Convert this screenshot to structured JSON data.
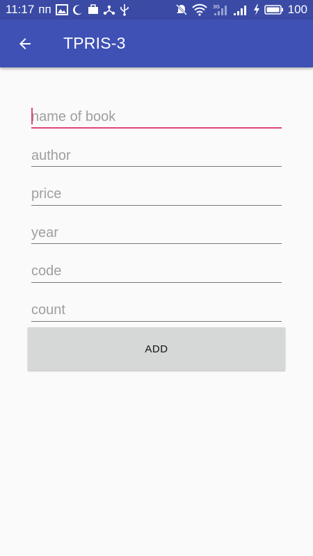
{
  "status_bar": {
    "time": "11:17",
    "carrier_text": "пп",
    "network_type": "3G",
    "battery_level": "100",
    "icons_left": [
      "image-icon",
      "moon-icon",
      "briefcase-icon",
      "share-icon",
      "usb-icon"
    ],
    "icons_right": [
      "mute-icon",
      "wifi-icon",
      "signal-3g-icon",
      "signal-icon",
      "charging-icon",
      "battery-icon"
    ]
  },
  "app_bar": {
    "title": "TPRIS-3",
    "back_icon": "arrow-back-icon",
    "color": "#3f51b5"
  },
  "form": {
    "fields": [
      {
        "placeholder": "name of book",
        "value": "",
        "focused": true
      },
      {
        "placeholder": "author",
        "value": ""
      },
      {
        "placeholder": "price",
        "value": ""
      },
      {
        "placeholder": "year",
        "value": ""
      },
      {
        "placeholder": "code",
        "value": ""
      },
      {
        "placeholder": "count",
        "value": ""
      }
    ],
    "accent_color": "#e0457a"
  },
  "add_button": {
    "label": "ADD"
  }
}
